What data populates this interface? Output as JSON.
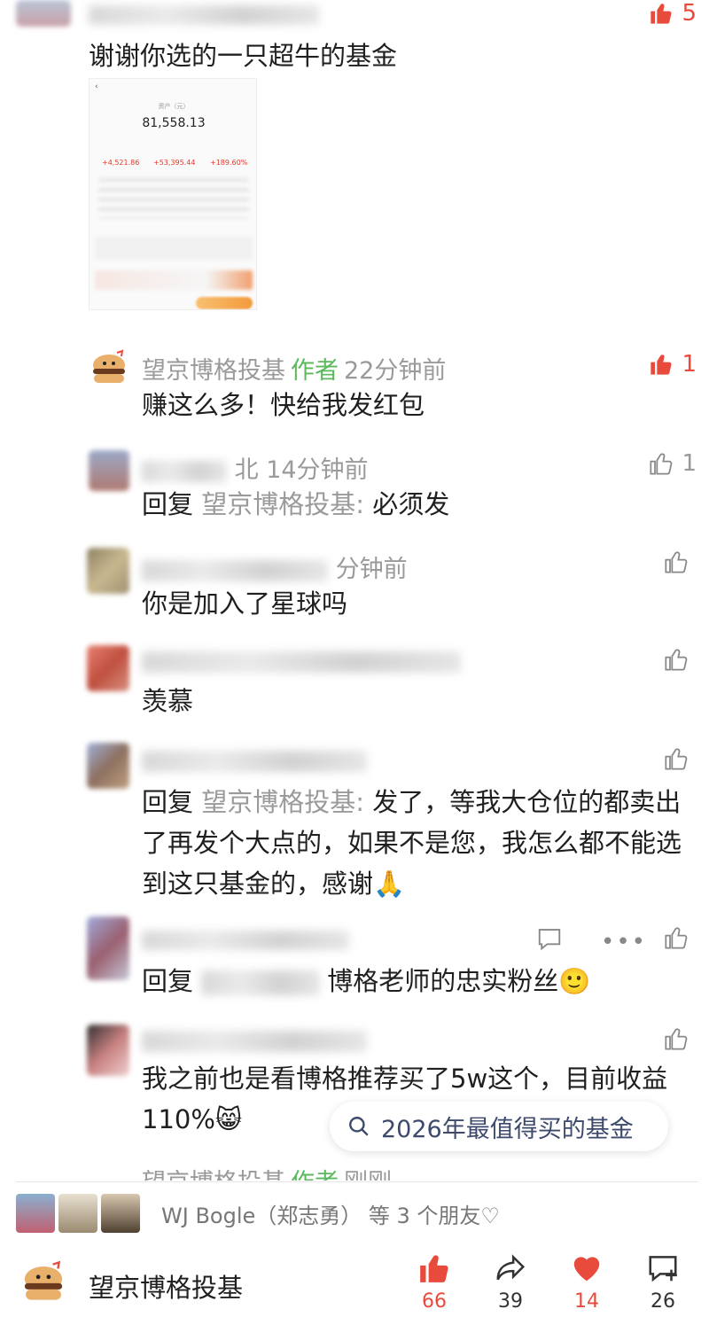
{
  "first_comment": {
    "text": "谢谢你选的一只超牛的基金",
    "likes": "5",
    "screenshot": {
      "asset_label": "资产（元）",
      "asset_value": "81,558.13",
      "stat1_value": "+4,521.86",
      "stat2_value": "+53,395.44",
      "stat3_value": "+189.60%"
    }
  },
  "comments": [
    {
      "name": "望京博格投基",
      "author_tag": "作者",
      "time": "22分钟前",
      "text": "赚这么多！快给我发红包",
      "likes": "1",
      "hot": true
    },
    {
      "name": "北",
      "time": "14分钟前",
      "reply_prefix": "回复 ",
      "reply_to": "望京博格投基",
      "text": "必须发",
      "likes": "1"
    },
    {
      "name": "",
      "time": "分钟前",
      "text": "你是加入了星球吗",
      "likes": ""
    },
    {
      "name": "",
      "time": "",
      "text": "羡慕",
      "likes": ""
    },
    {
      "name": "",
      "time": "",
      "reply_prefix": "回复 ",
      "reply_to": "望京博格投基",
      "text": "发了，等我大仓位的都卖出了再发个大点的，如果不是您，我怎么都不能选到这只基金的，感谢🙏",
      "likes": ""
    },
    {
      "name": "",
      "time": "",
      "reply_prefix": "回复 ",
      "text": "博格老师的忠实粉丝🙂",
      "likes": ""
    },
    {
      "name": "",
      "time": "",
      "text": "我之前也是看博格推荐买了5w这个，目前收益110%😸",
      "likes": ""
    },
    {
      "name": "望京博格投基",
      "author_tag": "作者",
      "time": "刚刚",
      "text": "",
      "likes": ""
    }
  ],
  "search_chip": {
    "text": "2026年最值得买的基金"
  },
  "friends": {
    "text": "WJ Bogle（郑志勇） 等 3 个朋友♡"
  },
  "bottom": {
    "account_name": "望京博格投基",
    "like_count": "66",
    "share_count": "39",
    "heart_count": "14",
    "comment_count": "26"
  },
  "colors": {
    "accent_red": "#e84b3c",
    "author_green": "#5cb85c",
    "muted": "#999999"
  }
}
